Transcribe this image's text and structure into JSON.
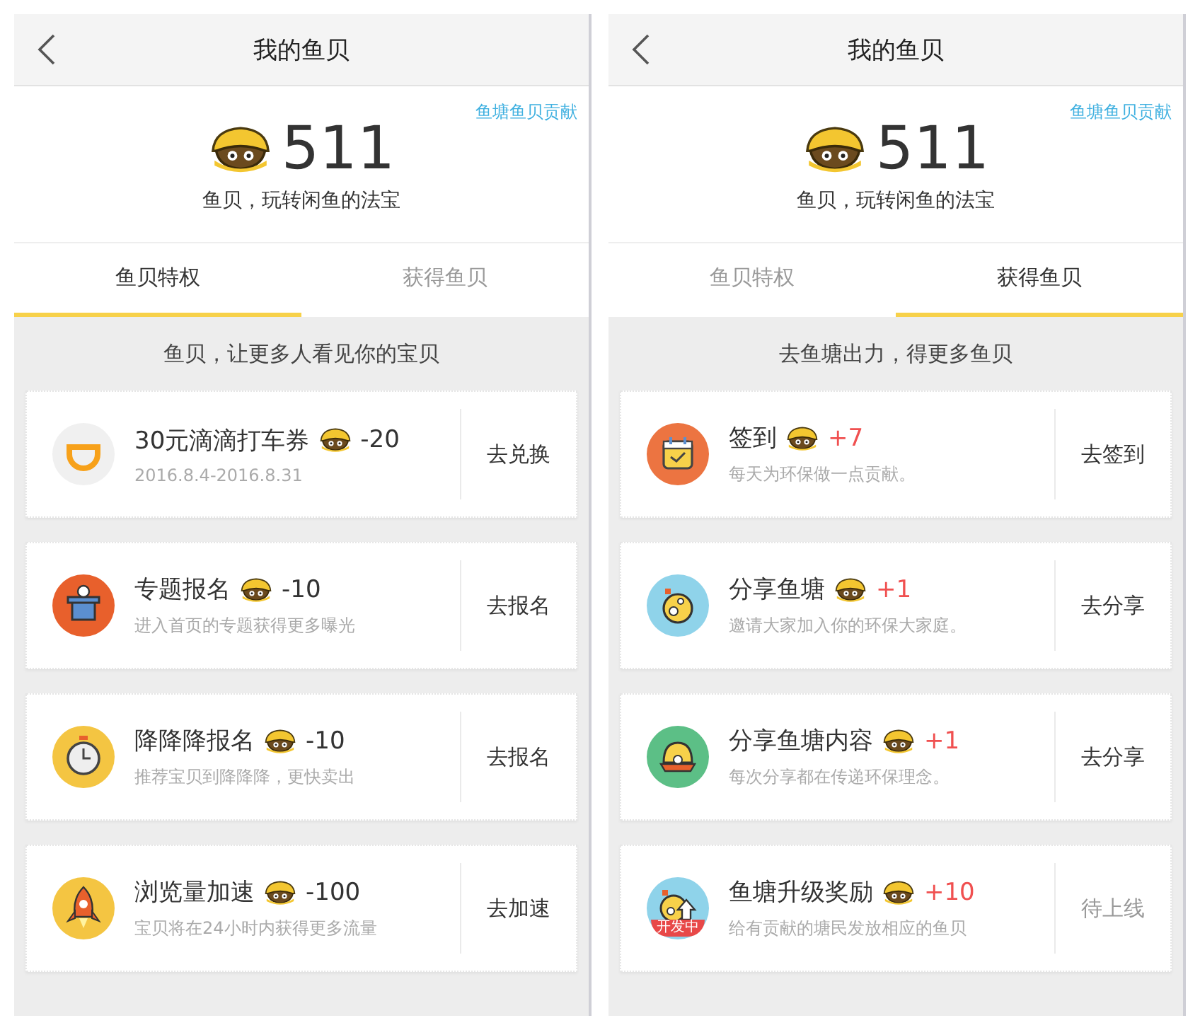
{
  "screens": [
    {
      "title": "我的鱼贝",
      "link": "鱼塘鱼贝贡献",
      "balance": "511",
      "tagline": "鱼贝，玩转闲鱼的法宝",
      "tabs": [
        {
          "label": "鱼贝特权",
          "selected": true
        },
        {
          "label": "获得鱼贝",
          "selected": false
        }
      ],
      "banner": "鱼贝，让更多人看见你的宝贝",
      "items": [
        {
          "kind": "didi",
          "title": "30元滴滴打车券",
          "amount": "-20",
          "reward": false,
          "subtitle": "2016.8.4-2016.8.31",
          "action": "去兑换",
          "disabled": false
        },
        {
          "kind": "hat",
          "title": "专题报名",
          "amount": "-10",
          "reward": false,
          "subtitle": "进入首页的专题获得更多曝光",
          "action": "去报名",
          "disabled": false
        },
        {
          "kind": "stopwatch",
          "title": "降降降报名",
          "amount": "-10",
          "reward": false,
          "subtitle": "推荐宝贝到降降降，更快卖出",
          "action": "去报名",
          "disabled": false
        },
        {
          "kind": "rocket",
          "title": "浏览量加速",
          "amount": "-100",
          "reward": false,
          "subtitle": "宝贝将在24小时内获得更多流量",
          "action": "去加速",
          "disabled": false
        }
      ]
    },
    {
      "title": "我的鱼贝",
      "link": "鱼塘鱼贝贡献",
      "balance": "511",
      "tagline": "鱼贝，玩转闲鱼的法宝",
      "tabs": [
        {
          "label": "鱼贝特权",
          "selected": false
        },
        {
          "label": "获得鱼贝",
          "selected": true
        }
      ],
      "banner": "去鱼塘出力，得更多鱼贝",
      "items": [
        {
          "kind": "calendar",
          "title": "签到",
          "amount": "+7",
          "reward": true,
          "subtitle": "每天为环保做一点贡献。",
          "action": "去签到",
          "disabled": false
        },
        {
          "kind": "planet",
          "title": "分享鱼塘",
          "amount": "+1",
          "reward": true,
          "subtitle": "邀请大家加入你的环保大家庭。",
          "action": "去分享",
          "disabled": false
        },
        {
          "kind": "pearl",
          "title": "分享鱼塘内容",
          "amount": "+1",
          "reward": true,
          "subtitle": "每次分享都在传递环保理念。",
          "action": "去分享",
          "disabled": false
        },
        {
          "kind": "upgrade",
          "badge": "开发中",
          "title": "鱼塘升级奖励",
          "amount": "+10",
          "reward": true,
          "subtitle": "给有贡献的塘民发放相应的鱼贝",
          "action": "待上线",
          "disabled": true
        }
      ]
    }
  ]
}
